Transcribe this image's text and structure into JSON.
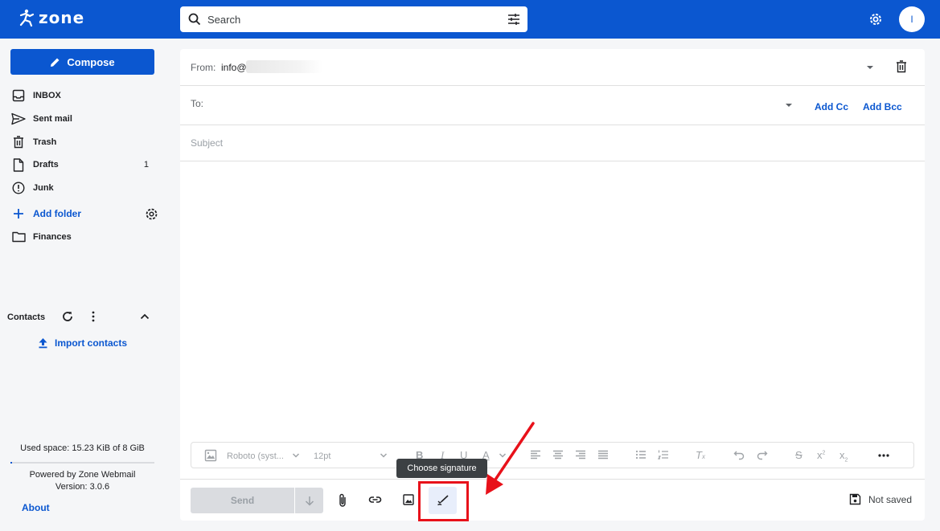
{
  "app": {
    "logo_text": "zone",
    "brand_color": "#0b57d0"
  },
  "search": {
    "placeholder": "Search"
  },
  "header": {
    "avatar_initial": "I"
  },
  "sidebar": {
    "compose_label": "Compose",
    "folders": [
      {
        "label": "INBOX",
        "icon": "inbox-icon"
      },
      {
        "label": "Sent mail",
        "icon": "send-icon"
      },
      {
        "label": "Trash",
        "icon": "trash-icon"
      },
      {
        "label": "Drafts",
        "icon": "draft-icon",
        "count": "1"
      },
      {
        "label": "Junk",
        "icon": "alert-circle-icon"
      }
    ],
    "add_folder_label": "Add folder",
    "custom_folders": [
      {
        "label": "Finances",
        "icon": "folder-icon"
      }
    ],
    "contacts_label": "Contacts",
    "import_contacts_label": "Import contacts",
    "used_space": "Used space: 15.23 KiB of 8 GiB",
    "used_fraction": 0.0001,
    "powered_by": "Powered by Zone Webmail",
    "version": "Version: 3.0.6",
    "about_label": "About"
  },
  "compose": {
    "from_label": "From:",
    "from_value": "info@",
    "to_label": "To:",
    "add_cc": "Add Cc",
    "add_bcc": "Add Bcc",
    "subject_placeholder": "Subject",
    "font_family": "Roboto (syst...",
    "font_size": "12pt",
    "send_label": "Send",
    "tooltip": "Choose signature",
    "save_status": "Not saved"
  },
  "annotation": {
    "color": "#e8111a"
  }
}
